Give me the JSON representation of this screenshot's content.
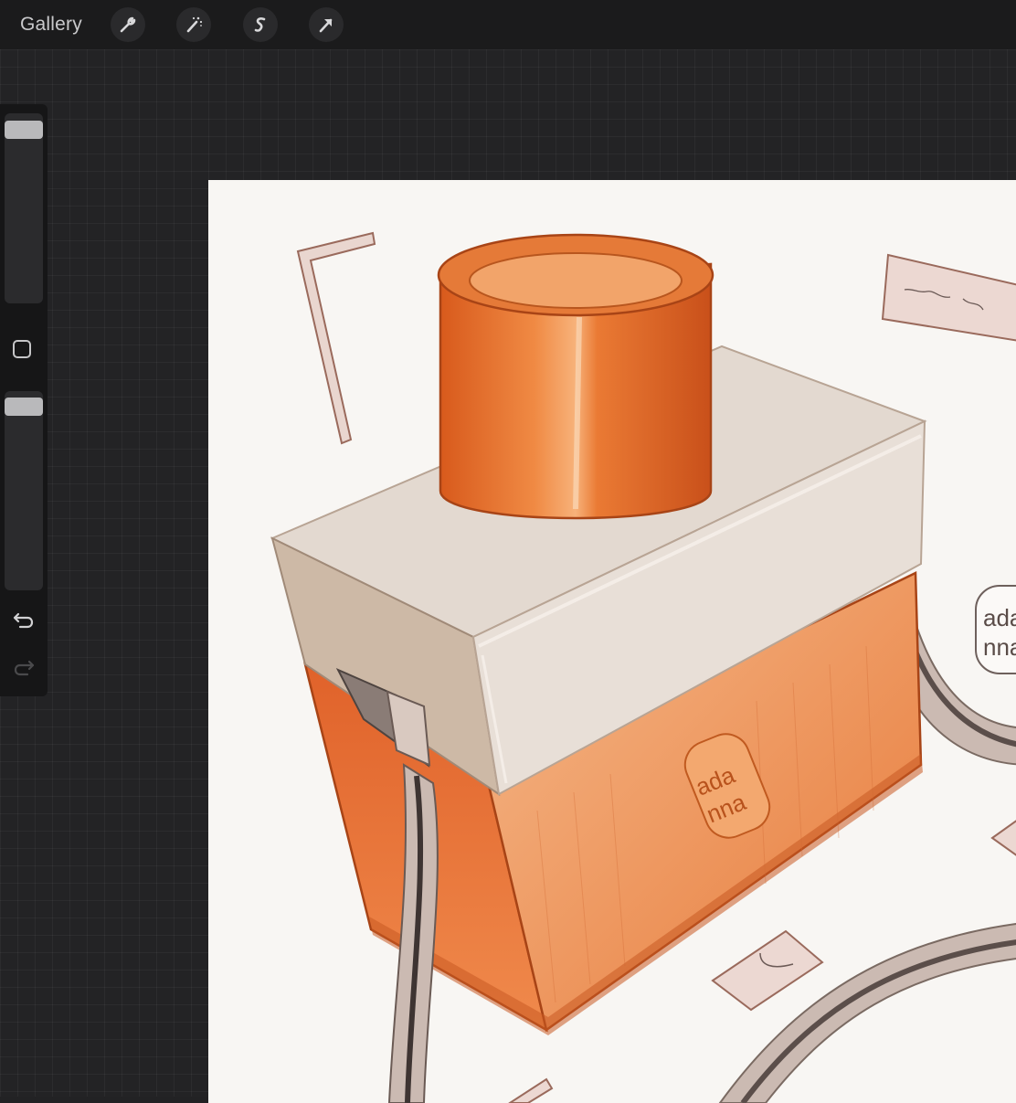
{
  "topbar": {
    "gallery_label": "Gallery",
    "tools": [
      {
        "name": "actions",
        "icon": "wrench-icon"
      },
      {
        "name": "adjustments",
        "icon": "magic-wand-icon"
      },
      {
        "name": "selection",
        "icon": "selection-s-icon"
      },
      {
        "name": "transform",
        "icon": "arrow-cursor-icon"
      }
    ]
  },
  "sidebar": {
    "brush_size_level": 0.95,
    "opacity_level": 0.95,
    "modify_icon": "square-icon",
    "undo_icon": "undo-icon",
    "redo_icon": "redo-icon"
  },
  "artwork": {
    "logo_line1": "ada",
    "logo_line2": "nna",
    "note": "~m logo",
    "colors": {
      "orange": "#e8702a",
      "orange_dark": "#b84a14",
      "lid": "#e4dcd4",
      "strap": "#7a6a62",
      "paper": "#f8f6f3"
    }
  }
}
